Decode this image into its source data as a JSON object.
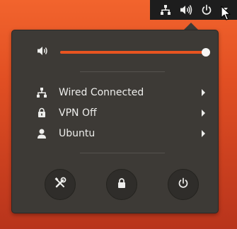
{
  "panel": {
    "icons": [
      "network-wired-icon",
      "volume-high-icon",
      "power-icon",
      "dropdown-arrow-icon"
    ]
  },
  "menu": {
    "volume": {
      "level": 0.98
    },
    "items": [
      {
        "label": "Wired Connected",
        "icon": "network-wired-icon"
      },
      {
        "label": "VPN Off",
        "icon": "vpn-lock-icon"
      },
      {
        "label": "Ubuntu",
        "icon": "user-icon"
      }
    ],
    "buttons": [
      "settings-icon",
      "lock-icon",
      "power-off-icon"
    ]
  },
  "colors": {
    "accent": "#e95420",
    "menu_bg": "#3d3a36",
    "panel_bg": "#1d1d1d",
    "text": "#eeeeec"
  }
}
